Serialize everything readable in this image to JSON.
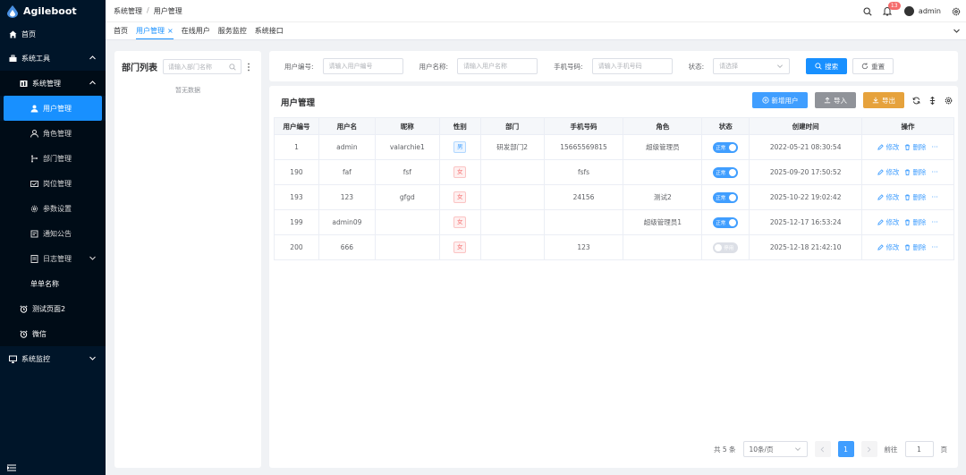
{
  "app": {
    "name": "Agileboot"
  },
  "sidebar": {
    "items": [
      {
        "label": "首页",
        "icon": "home-icon"
      },
      {
        "label": "系统工具",
        "icon": "toolbox-icon"
      },
      {
        "label": "系统管理",
        "icon": "chart-icon"
      },
      {
        "label": "用户管理",
        "icon": "user-icon"
      },
      {
        "label": "角色管理",
        "icon": "user-outline-icon"
      },
      {
        "label": "部门管理",
        "icon": "branch-icon"
      },
      {
        "label": "岗位管理",
        "icon": "post-icon"
      },
      {
        "label": "参数设置",
        "icon": "gear-icon"
      },
      {
        "label": "通知公告",
        "icon": "notice-icon"
      },
      {
        "label": "日志管理",
        "icon": "log-icon"
      },
      {
        "label": "单单名称",
        "icon": ""
      },
      {
        "label": "测试页面2",
        "icon": "alarm-icon"
      },
      {
        "label": "微信",
        "icon": "alarm-icon"
      },
      {
        "label": "系统监控",
        "icon": "monitor-icon"
      }
    ]
  },
  "header": {
    "breadcrumb": [
      "系统管理",
      "用户管理"
    ],
    "separator": "/",
    "notification_count": "13",
    "username": "admin"
  },
  "tabs": [
    {
      "label": "首页"
    },
    {
      "label": "用户管理",
      "close": "×"
    },
    {
      "label": "在线用户"
    },
    {
      "label": "服务监控"
    },
    {
      "label": "系统接口"
    }
  ],
  "dept": {
    "title": "部门列表",
    "search_placeholder": "请输入部门名称",
    "empty": "暂无数据"
  },
  "filter": {
    "user_id_label": "用户编号:",
    "user_id_placeholder": "请输入用户编号",
    "username_label": "用户名称:",
    "username_placeholder": "请输入用户名称",
    "phone_label": "手机号码:",
    "phone_placeholder": "请输入手机号码",
    "status_label": "状态:",
    "status_placeholder": "请选择",
    "search": "搜索",
    "reset": "重置"
  },
  "main": {
    "title": "用户管理",
    "add": "新增用户",
    "import": "导入",
    "export": "导出"
  },
  "table": {
    "headers": [
      "用户编号",
      "用户名",
      "昵称",
      "性别",
      "部门",
      "手机号码",
      "角色",
      "状态",
      "创建时间",
      "操作"
    ],
    "rows": [
      {
        "id": "1",
        "username": "admin",
        "nickname": "valarchie1",
        "sex": "男",
        "sex_type": "male",
        "dept": "研发部门2",
        "phone": "15665569815",
        "role": "超级管理员",
        "status": "正常",
        "status_on": true,
        "created": "2022-05-21 08:30:54"
      },
      {
        "id": "190",
        "username": "faf",
        "nickname": "fsf",
        "sex": "女",
        "sex_type": "female",
        "dept": "",
        "phone": "fsfs",
        "role": "",
        "status": "正常",
        "status_on": true,
        "created": "2025-09-20 17:50:52"
      },
      {
        "id": "193",
        "username": "123",
        "nickname": "gfgd",
        "sex": "女",
        "sex_type": "female",
        "dept": "",
        "phone": "24156",
        "role": "测试2",
        "status": "正常",
        "status_on": true,
        "created": "2025-10-22 19:02:42"
      },
      {
        "id": "199",
        "username": "admin09",
        "nickname": "",
        "sex": "女",
        "sex_type": "female",
        "dept": "",
        "phone": "",
        "role": "超级管理员1",
        "status": "正常",
        "status_on": true,
        "created": "2025-12-17 16:53:24"
      },
      {
        "id": "200",
        "username": "666",
        "nickname": "",
        "sex": "女",
        "sex_type": "female",
        "dept": "",
        "phone": "123",
        "role": "",
        "status": "停用",
        "status_on": false,
        "created": "2025-12-18 21:42:10"
      }
    ],
    "ops": {
      "edit": "修改",
      "delete": "删除",
      "more": "···"
    }
  },
  "pagination": {
    "total": "共 5 条",
    "page_size": "10条/页",
    "current_page": "1",
    "goto_label": "前往",
    "goto_value": "1",
    "page_suffix": "页"
  },
  "colors": {
    "sidebar_bg": "#001529",
    "primary": "#1890ff",
    "warning": "#e6a23c",
    "info": "#909399",
    "danger": "#f56c6c"
  }
}
